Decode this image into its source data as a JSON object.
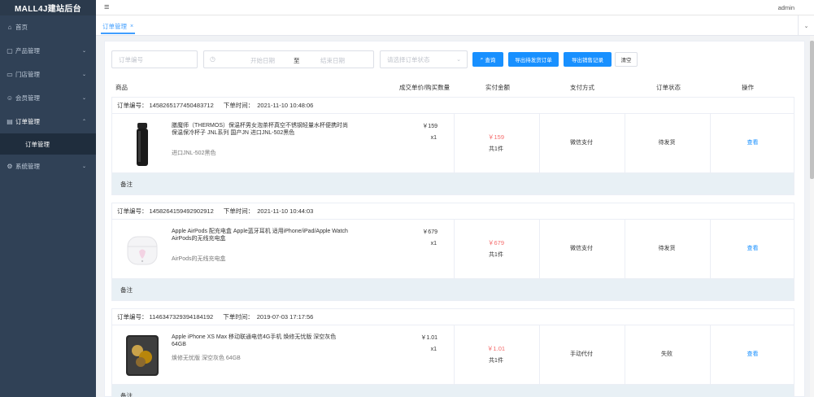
{
  "sidebar": {
    "title": "MALL4J建站后台",
    "menu": [
      {
        "label": "首页",
        "icon": "home-icon"
      },
      {
        "label": "产品管理",
        "icon": "product-icon"
      },
      {
        "label": "门店管理",
        "icon": "store-icon"
      },
      {
        "label": "会员管理",
        "icon": "member-icon"
      },
      {
        "label": "订单管理",
        "icon": "order-icon"
      },
      {
        "label": "订单管理"
      },
      {
        "label": "系统管理",
        "icon": "gear-icon"
      }
    ]
  },
  "header": {
    "user": "admin"
  },
  "tabs": [
    {
      "label": "订单管理"
    }
  ],
  "filters": {
    "order_no_placeholder": "订单编号",
    "start_date_placeholder": "开始日期",
    "range_separator": "至",
    "end_date_placeholder": "结束日期",
    "status_placeholder": "请选择订单状态",
    "search_label": "查询",
    "export_pending_label": "导出待发货订单",
    "export_sales_label": "导出销售记录",
    "clear_label": "清空"
  },
  "table": {
    "columns": [
      "商品",
      "成交单价/购买数量",
      "实付金额",
      "支付方式",
      "订单状态",
      "操作"
    ],
    "order_no_label": "订单编号：",
    "order_time_label": "下单时间：",
    "remark_label": "备注",
    "view_label": "查看"
  },
  "orders": [
    {
      "order_no": "1458265177450483712",
      "time": "2021-11-10 10:48:06",
      "product_name": "膳魔师（THERMOS）保温杯男女泡茶杯真空不锈钢轻量水杯便携时尚保温保冷杯子 JNL系列 国产JN 进口JNL-502黑色",
      "spec": "进口JNL-502黑色",
      "unit_price": "￥159",
      "quantity": "x1",
      "paid": "￥159",
      "count": "共1件",
      "pay_method": "微信支付",
      "status": "待发货"
    },
    {
      "order_no": "1458264159492902912",
      "time": "2021-11-10 10:44:03",
      "product_name": "Apple AirPods 配充电盒 Apple蓝牙耳机 适用iPhone/iPad/Apple Watch AirPods的无线充电盒",
      "spec": "AirPods的无线充电盒",
      "unit_price": "￥679",
      "quantity": "x1",
      "paid": "￥679",
      "count": "共1件",
      "pay_method": "微信支付",
      "status": "待发货"
    },
    {
      "order_no": "1146347329394184192",
      "time": "2019-07-03 17:17:56",
      "product_name": "Apple iPhone XS Max 移动联通电信4G手机 焕修无忧版 深空灰色 64GB",
      "spec": "焕修无忧版 深空灰色 64GB",
      "unit_price": "￥1.01",
      "quantity": "x1",
      "paid": "￥1.01",
      "count": "共1件",
      "pay_method": "手动代付",
      "status": "失败"
    }
  ],
  "colors": {
    "sidebar": "#304156",
    "accent": "#1890ff",
    "price": "#f56c6c",
    "remark_bg": "#e8f0f5"
  }
}
